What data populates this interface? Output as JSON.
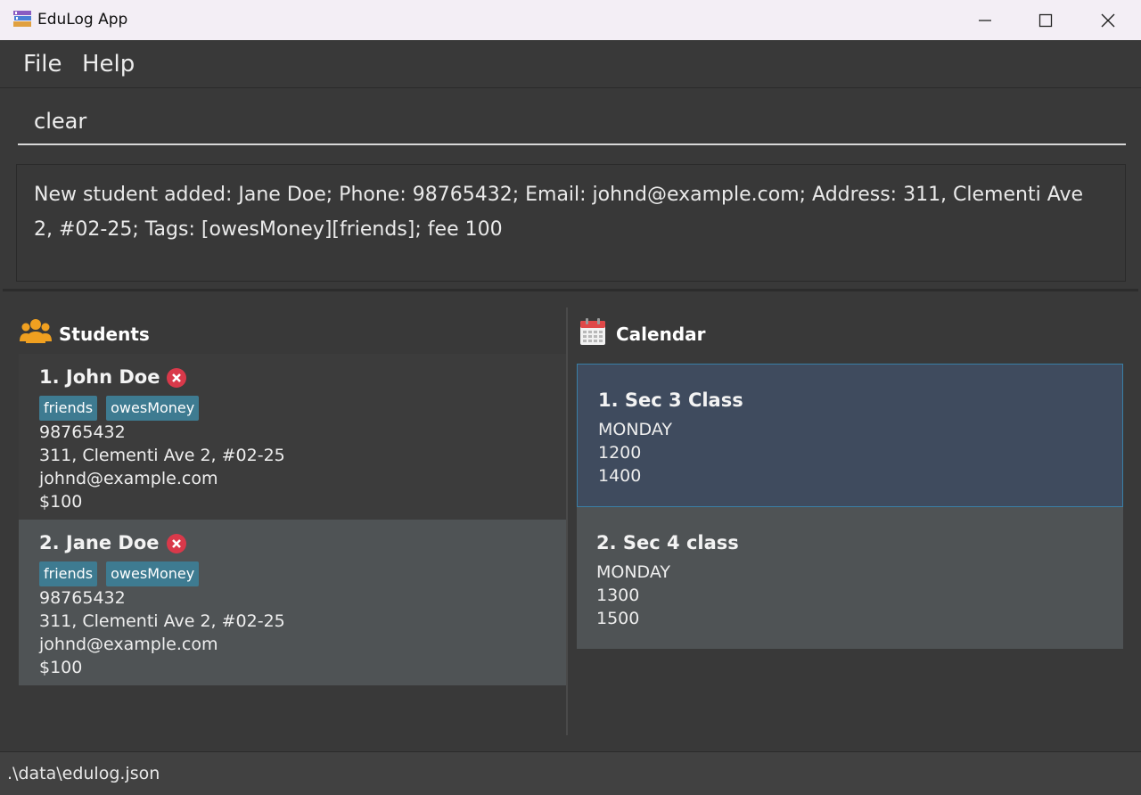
{
  "window": {
    "title": "EduLog App"
  },
  "menu": {
    "file": "File",
    "help": "Help"
  },
  "command": {
    "value": "clear"
  },
  "result": {
    "message": "New student added: Jane Doe; Phone: 98765432; Email: johnd@example.com; Address: 311, Clementi Ave 2, #02-25; Tags: [owesMoney][friends]; fee 100"
  },
  "students": {
    "title": "Students",
    "items": [
      {
        "name": "1. John Doe",
        "tags": [
          "friends",
          "owesMoney"
        ],
        "phone": "98765432",
        "address": "311, Clementi Ave 2, #02-25",
        "email": "johnd@example.com",
        "fee": "$100"
      },
      {
        "name": "2. Jane Doe",
        "tags": [
          "friends",
          "owesMoney"
        ],
        "phone": "98765432",
        "address": "311, Clementi Ave 2, #02-25",
        "email": "johnd@example.com",
        "fee": "$100"
      }
    ]
  },
  "calendar": {
    "title": "Calendar",
    "items": [
      {
        "name": "1. Sec 3 Class",
        "day": "MONDAY",
        "start": "1200",
        "end": "1400"
      },
      {
        "name": "2. Sec 4 class",
        "day": "MONDAY",
        "start": "1300",
        "end": "1500"
      }
    ]
  },
  "status": {
    "path": ".\\data\\edulog.json"
  },
  "colors": {
    "tag": "#3e7b91",
    "selected_event": "#3f4b5e",
    "delete": "#d9394a"
  }
}
